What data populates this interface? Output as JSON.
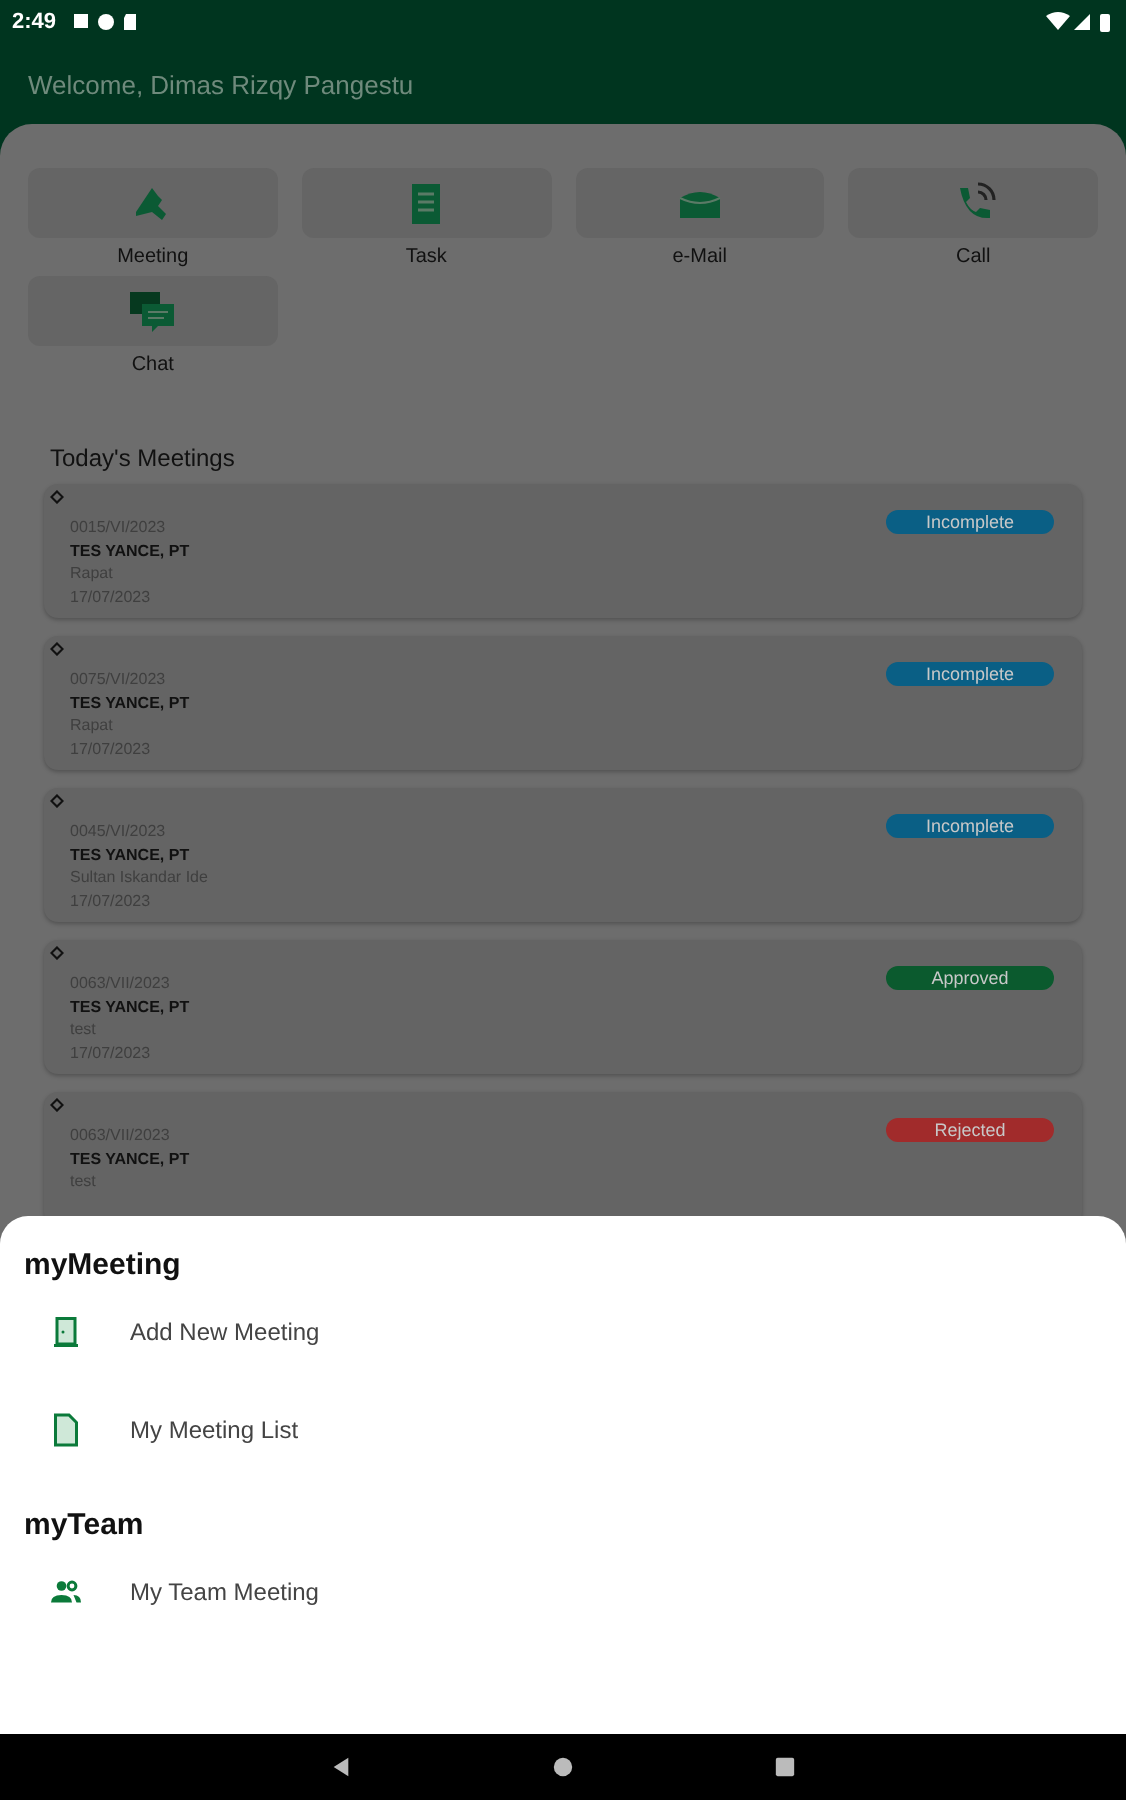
{
  "status_bar": {
    "time": "2:49"
  },
  "header": {
    "title": "Welcome, Dimas Rizqy Pangestu"
  },
  "menu": [
    {
      "label": "Meeting",
      "kind": "meeting"
    },
    {
      "label": "Task",
      "kind": "task"
    },
    {
      "label": "e-Mail",
      "kind": "mail"
    },
    {
      "label": "Call",
      "kind": "call"
    },
    {
      "label": "Chat",
      "kind": "chat"
    }
  ],
  "meetings_title": "Today's Meetings",
  "meetings": [
    {
      "number": "0015/VI/2023",
      "company": "TES YANCE, PT",
      "place": "Rapat",
      "date": "17/07/2023",
      "status": "Incomplete",
      "color": "#0a5f85"
    },
    {
      "number": "0075/VI/2023",
      "company": "TES YANCE, PT",
      "place": "Rapat",
      "date": "17/07/2023",
      "status": "Incomplete",
      "color": "#0a5f85"
    },
    {
      "number": "0045/VI/2023",
      "company": "TES YANCE, PT",
      "place": "Sultan Iskandar Ide",
      "date": "17/07/2023",
      "status": "Incomplete",
      "color": "#0a5f85"
    },
    {
      "number": "0063/VII/2023",
      "company": "TES YANCE, PT",
      "place": "test",
      "date": "17/07/2023",
      "status": "Approved",
      "color": "#0b5a2e"
    },
    {
      "number": "0063/VII/2023",
      "company": "TES YANCE, PT",
      "place": "test",
      "status": "Rejected",
      "color": "#a12b2b"
    }
  ],
  "sheet": {
    "sections": [
      {
        "title": "myMeeting",
        "items": [
          {
            "label": "Add New Meeting",
            "kind": "add"
          },
          {
            "label": "My Meeting List",
            "kind": "list"
          }
        ]
      },
      {
        "title": "myTeam",
        "items": [
          {
            "label": "My Team Meeting",
            "kind": "team"
          }
        ]
      }
    ]
  }
}
